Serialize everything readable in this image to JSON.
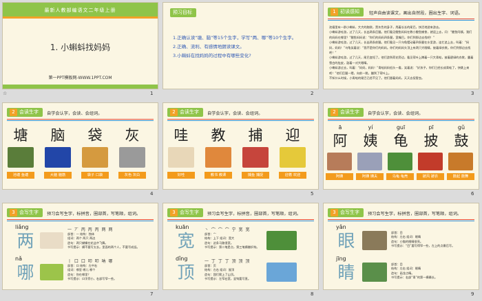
{
  "slides": [
    {
      "number": "1",
      "corner": "☆",
      "top_title": "最新人教部编语文二年级上册",
      "lesson_title": "1. 小蝌蚪找妈妈",
      "footer": "第一PPT模板网-WWW.1PPT.COM"
    },
    {
      "number": "2",
      "header": "预习目标",
      "goals": [
        "1.正确认读“塘、脑”等15个生字，学写“两、哪”等10个生字。",
        "2.正确、流利、有感情地朗读课文。",
        "3.小蝌蚪在找妈妈的过程中有哪些变化?"
      ]
    },
    {
      "number": "3",
      "header_num": "1",
      "header": "初读感知",
      "side": "轻声自由读课文，画出自然段，圈出生字、词语。",
      "paragraph": [
        "池塘里有一群小蝌蚪，大大的脑袋，黑灰色的身子，甩着长长的尾巴，快活地游来游去。",
        "小蝌蚪游哇游，过了几天，长出两条后腿。他们看见鲤鱼妈妈在教小鲤鱼捕食，就迎上去，问：“鲤鱼阿姨，我们的妈妈在哪里？”鲤鱼妈妈说：“你们的妈妈四条腿，宽嘴巴。你们到那边去找吧！”",
        "小蝌蚪游哇游，过了几天，长出两条前腿。他们看见一只乌龟摆动着四条腿在水里游，连忙追上去，叫着：“妈妈，妈妈！”乌龟笑着说：“我不是你们的妈妈。你们的妈妈头顶上有两只大眼睛，披着绿衣裳。你们到那边去找吧！”",
        "小蝌蚪游哇游，过了几天，尾巴变短了。他们游到荷花旁边，看见荷叶上蹲着一只大青蛙，披着碧绿的衣裳，露着雪白的肚皮，鼓着一对大眼睛。",
        "小蝌蚪游过去，叫着：“妈妈，妈妈！”青蛙妈妈低头一看，笑着说：“好孩子，你们已经长成青蛙了，快跳上来吧！”他们后腿一蹬，向前一跳，蹦到了荷叶上。",
        "不知什么时候，小青蛙的尾巴已经不见了。他们跟着妈妈，天天去捉害虫。"
      ]
    },
    {
      "number": "4",
      "header_num": "2",
      "header": "会读生字",
      "side": "自学会认字，会读、会组词。",
      "chars": [
        "塘",
        "脑",
        "袋",
        "灰"
      ],
      "tags": [
        "池塘  鱼塘",
        "大脑  脑筋",
        "袋子  口袋",
        "灰色  灰白"
      ],
      "pic_colors": [
        "#5a7d3a",
        "#2246a8",
        "#d59a3f",
        "#9a9a9a"
      ]
    },
    {
      "number": "5",
      "header_num": "2",
      "header": "会读生字",
      "side": "自学会认字，会读、会组词。",
      "chars": [
        "哇",
        "教",
        "捕",
        "迎"
      ],
      "tags": [
        "好哇",
        "教书  教课",
        "捕鱼  捕捉",
        "迎着  欢迎"
      ],
      "pic_colors": [
        "#e8d7b8",
        "#e0883c",
        "#c6453c",
        "#e5c93a"
      ]
    },
    {
      "number": "6",
      "header_num": "2",
      "header": "会读生字",
      "side": "自学会认字，会读、会组词。",
      "pinyin": [
        "ā",
        "yí",
        "guī",
        "pī",
        "gǔ"
      ],
      "chars": [
        "阿",
        "姨",
        "龟",
        "披",
        "鼓"
      ],
      "tags": [
        "阿姨",
        "阿姨  姨夫",
        "乌龟  龟壳",
        "披风  披衣",
        "鼓起  鼓舞"
      ],
      "pic_colors": [
        "#b77c5a",
        "#9aa0b8",
        "#4e8f3a",
        "#c23b2a",
        "#c87a2a"
      ]
    },
    {
      "number": "7",
      "header_num": "3",
      "header": "会写生字",
      "side": "预习会写生字，标拼音，圈部首，写笔顺，组词。",
      "items": [
        {
          "pinyin": "liǎng",
          "char": "两",
          "strokes": "一 丆 丙 丙 丙 两 两",
          "meta": [
            "部首：一  结构：独体",
            "组词：两个  两只  两边",
            "造句：两只蝴蝶在花丛中飞舞。",
            "书写提示：横不要写太长。里面的两个人，不要写成竖。"
          ],
          "thumb": "#e9dcc6"
        },
        {
          "pinyin": "nǎ",
          "char": "哪",
          "strokes": "丨 口 口 叩 叩 呐 哪",
          "meta": [
            "部首：口  结构：左中右",
            "组词：哪里  哪儿  哪个",
            "造句：你在哪里？",
            "书写提示：口字旁小，右部写窄一些。"
          ],
          "thumb": "#9cc44a"
        }
      ]
    },
    {
      "number": "8",
      "header_num": "3",
      "header": "会写生字",
      "side": "预习会写生字，标拼音，圈部首，写笔顺，组词。",
      "items": [
        {
          "pinyin": "kuān",
          "char": "宽",
          "strokes": "丶 宀 宀 宀 宁 宽 宽",
          "meta": [
            "部首：宀",
            "结构：上下  组词：宽大",
            "造句：这条马路很宽。",
            "书写提示：第二笔是点，第三笔横撇折钩。"
          ],
          "thumb": "#4e8f3a"
        },
        {
          "pinyin": "dǐng",
          "char": "顶",
          "strokes": "一 丁 丁 丁 顶 顶 顶",
          "meta": [
            "部首：页",
            "结构：左右  组词：屋顶",
            "造句：我们爬上了山顶。",
            "书写提示：左窄右宽，竖钩要写直。"
          ],
          "thumb": "#6aa6d8"
        }
      ]
    },
    {
      "number": "9",
      "header_num": "3",
      "header": "会写生字",
      "side": "预习会写生字，标拼音，圈部首，写笔顺，组词。",
      "items": [
        {
          "pinyin": "yǎn",
          "char": "眼",
          "strokes": "",
          "meta": [
            "部首：目",
            "结构：左右  组词：眼睛",
            "造句：小猫的眼睛很亮。",
            "书写提示：“目”要写得窄一些，左上的点最后写。"
          ],
          "thumb": "#8a7a5a"
        },
        {
          "pinyin": "jīng",
          "char": "睛",
          "strokes": "",
          "meta": [
            "部首：目",
            "结构：左右  组词：眼睛",
            "造句：画龙点睛。",
            "书写提示：右部“青”的第一横最长。"
          ],
          "thumb": "#5a8f4a"
        }
      ]
    }
  ]
}
